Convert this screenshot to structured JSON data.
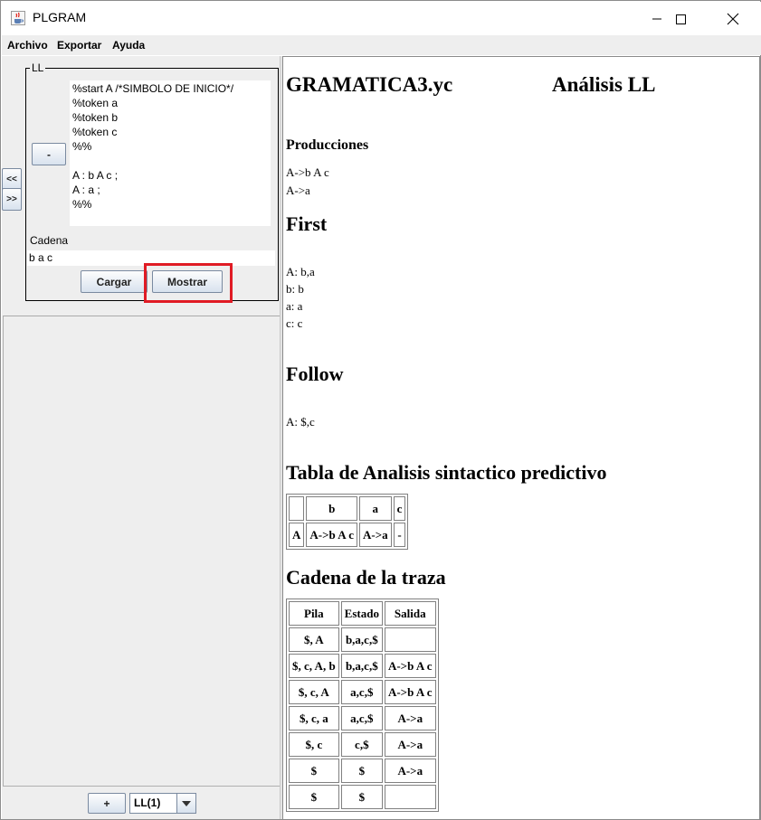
{
  "window": {
    "title": "PLGRAM"
  },
  "menu": {
    "items": [
      "Archivo",
      "Exportar",
      "Ayuda"
    ]
  },
  "left": {
    "group_title": "LL",
    "collapse_button": "-",
    "nav_left": "<<",
    "nav_right": ">>",
    "grammar_lines": [
      "%start A /*SIMBOLO DE INICIO*/",
      "%token a",
      "%token b",
      "%token c",
      "%%",
      "",
      "A : b A c ;",
      "A : a ;",
      "%%"
    ],
    "cadena_label": "Cadena",
    "cadena_value": "b a c",
    "cargar_label": "Cargar",
    "mostrar_label": "Mostrar",
    "add_label": "+",
    "combo_value": "LL(1)"
  },
  "report": {
    "file_name": "GRAMATICA3.yc",
    "analysis_title": "Análisis LL",
    "producciones_title": "Producciones",
    "producciones": [
      "A->b A c",
      "A->a"
    ],
    "first_title": "First",
    "first": [
      "A: b,a",
      "b: b",
      "a: a",
      "c: c"
    ],
    "follow_title": "Follow",
    "follow": [
      "A: $,c"
    ],
    "tabla_title": "Tabla de Analisis sintactico predictivo",
    "tabla": {
      "header": [
        "",
        "b",
        "a",
        "c"
      ],
      "rows": [
        [
          "A",
          "A->b A c",
          "A->a",
          "-"
        ]
      ]
    },
    "traza_title": "Cadena de la traza",
    "traza": {
      "header": [
        "Pila",
        "Estado",
        "Salida"
      ],
      "rows": [
        [
          "$, A",
          "b,a,c,$",
          ""
        ],
        [
          "$, c, A, b",
          "b,a,c,$",
          "A->b A c"
        ],
        [
          "$, c, A",
          "a,c,$",
          "A->b A c"
        ],
        [
          "$, c, a",
          "a,c,$",
          "A->a"
        ],
        [
          "$, c",
          "c,$",
          "A->a"
        ],
        [
          "$",
          "$",
          "A->a"
        ],
        [
          "$",
          "$",
          ""
        ]
      ]
    }
  }
}
